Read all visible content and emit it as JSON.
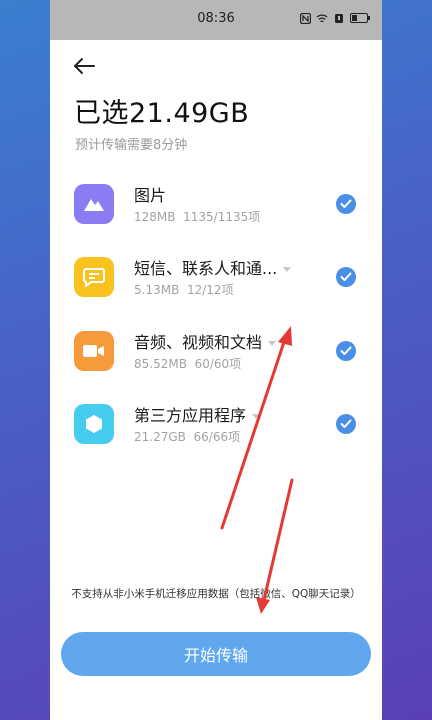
{
  "status": {
    "time": "08:36"
  },
  "header": {
    "title": "已选21.49GB",
    "subtitle": "预计传输需要8分钟"
  },
  "items": [
    {
      "name": "图片",
      "size": "128MB",
      "count": "1135/1135项",
      "icon": "image-icon",
      "color": "#8a7cf2",
      "expandable": false
    },
    {
      "name": "短信、联系人和通...",
      "size": "5.13MB",
      "count": "12/12项",
      "icon": "message-icon",
      "color": "#f9c21f",
      "expandable": true
    },
    {
      "name": "音频、视频和文档",
      "size": "85.52MB",
      "count": "60/60项",
      "icon": "video-icon",
      "color": "#f79a3c",
      "expandable": true
    },
    {
      "name": "第三方应用程序",
      "size": "21.27GB",
      "count": "66/66项",
      "icon": "app-icon",
      "color": "#45cdf0",
      "expandable": true
    }
  ],
  "note": "不支持从非小米手机迁移应用数据（包括微信、QQ聊天记录）",
  "start_button": "开始传输",
  "accent": "#60a7ee",
  "annotation_color": "#e53935"
}
